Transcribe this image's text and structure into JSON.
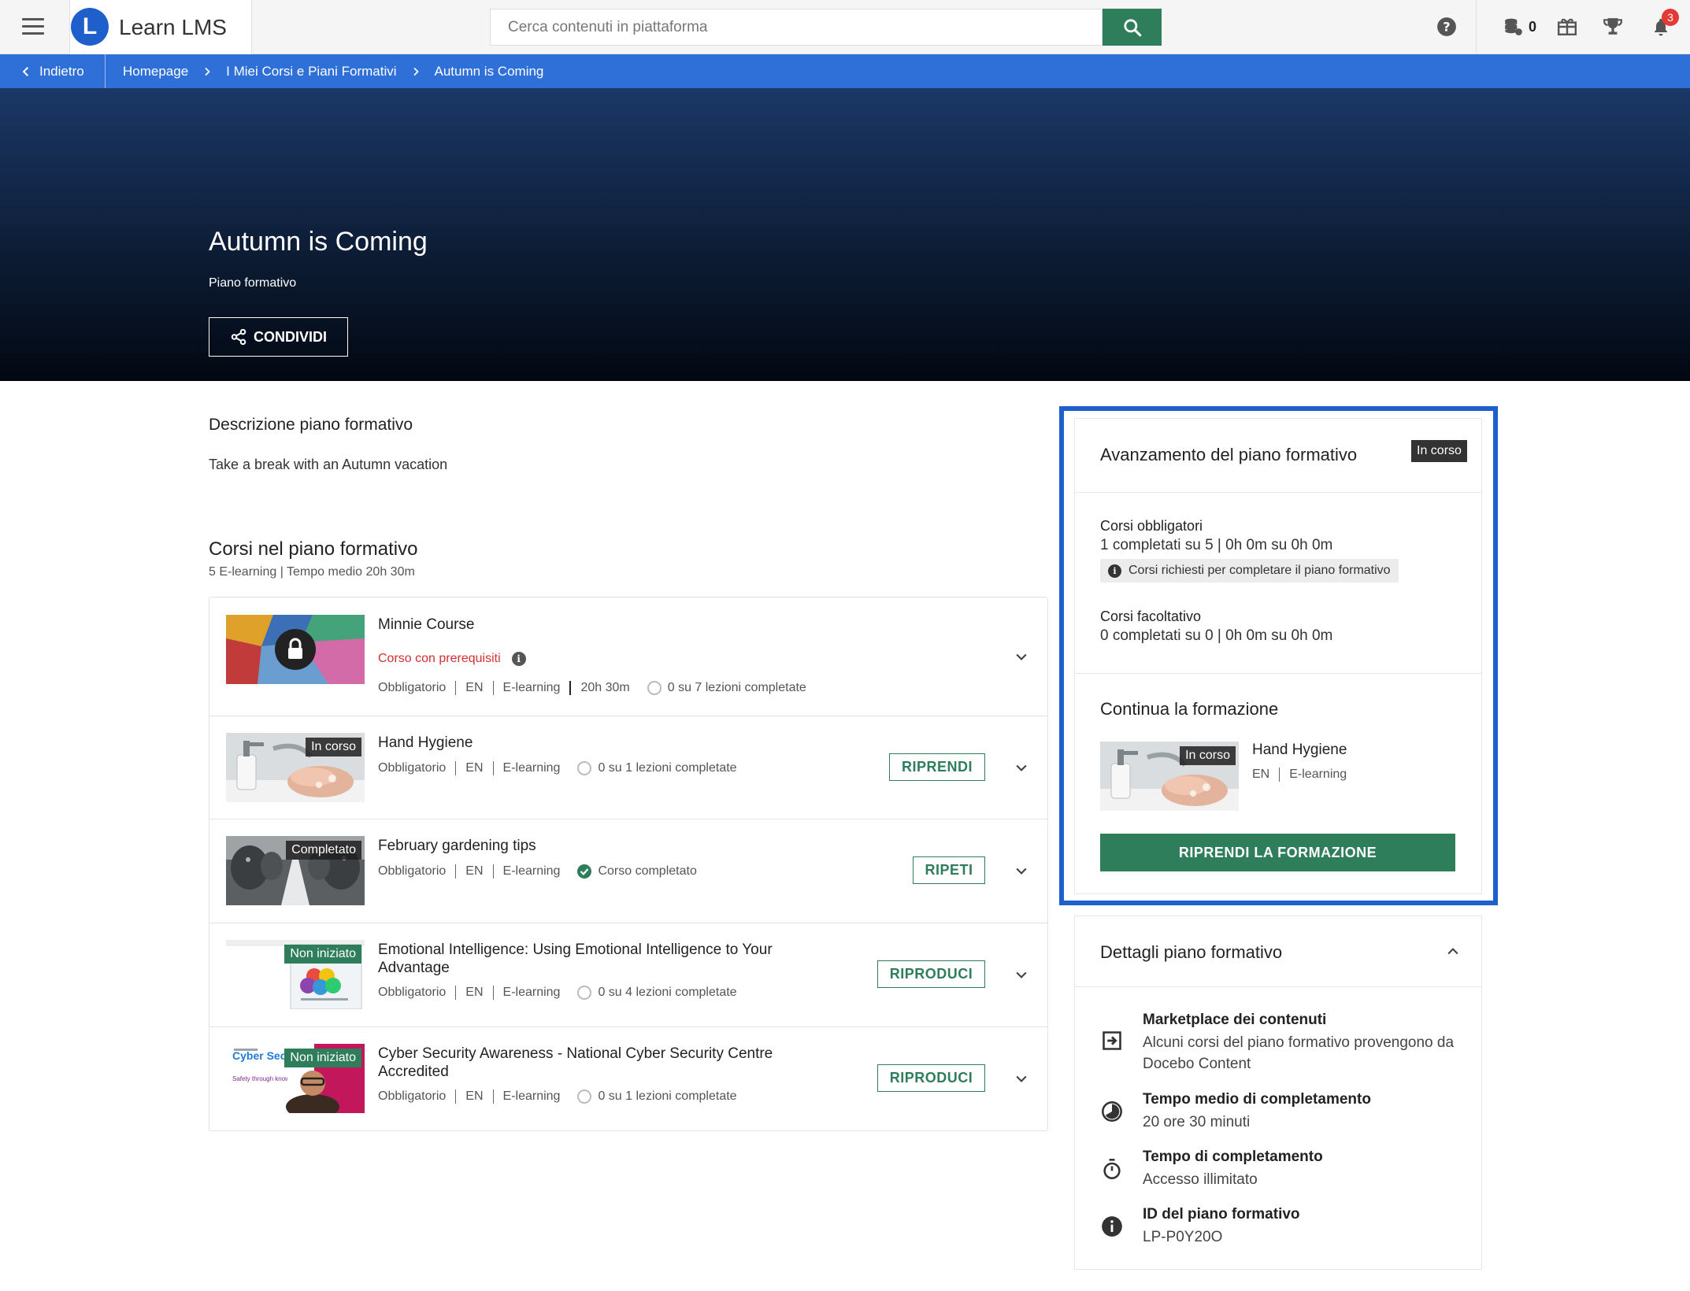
{
  "header": {
    "brand_name": "Learn LMS",
    "brand_logo_letter": "L",
    "search_placeholder": "Cerca contenuti in piattaforma",
    "coins_count": "0",
    "notifications_count": "3",
    "icons": [
      "menu-icon",
      "search-icon",
      "help-icon",
      "coins-icon",
      "gift-icon",
      "trophy-icon",
      "bell-icon"
    ]
  },
  "breadcrumb": {
    "back_label": "Indietro",
    "items": [
      "Homepage",
      "I Miei Corsi e Piani Formativi",
      "Autumn is Coming"
    ]
  },
  "hero": {
    "title": "Autumn is Coming",
    "subtitle": "Piano formativo",
    "share_label": "CONDIVIDI"
  },
  "description": {
    "title": "Descrizione piano formativo",
    "text": "Take a break with an Autumn vacation"
  },
  "courses": {
    "title": "Corsi nel piano formativo",
    "meta": "5 E-learning | Tempo medio 20h 30m",
    "items": [
      {
        "title": "Minnie Course",
        "prereq": "Corso con prerequisiti",
        "type": "Obbligatorio",
        "lang": "EN",
        "format": "E-learning",
        "duration": "20h 30m",
        "progress": "0 su 7 lezioni completate"
      },
      {
        "title": "Hand Hygiene",
        "badge": "In corso",
        "type": "Obbligatorio",
        "lang": "EN",
        "format": "E-learning",
        "progress": "0 su 1 lezioni completate",
        "action": "RIPRENDI"
      },
      {
        "title": "February gardening tips",
        "badge": "Completato",
        "type": "Obbligatorio",
        "lang": "EN",
        "format": "E-learning",
        "progress": "Corso completato",
        "action": "RIPETI"
      },
      {
        "title": "Emotional Intelligence: Using Emotional Intelligence to Your Advantage",
        "badge": "Non iniziato",
        "type": "Obbligatorio",
        "lang": "EN",
        "format": "E-learning",
        "progress": "0 su 4 lezioni completate",
        "action": "RIPRODUCI"
      },
      {
        "title": "Cyber Security Awareness - National Cyber Security Centre Accredited",
        "badge": "Non iniziato",
        "thumb_text": "Cyber Security Awareness",
        "thumb_small": "Safety through knowledge",
        "type": "Obbligatorio",
        "lang": "EN",
        "format": "E-learning",
        "progress": "0 su 1 lezioni completate",
        "action": "RIPRODUCI"
      }
    ]
  },
  "progress_panel": {
    "title": "Avanzamento del piano formativo",
    "status": "In corso",
    "mandatory_label": "Corsi obbligatori",
    "mandatory_value": "1 completati su 5 | 0h 0m su 0h 0m",
    "mandatory_note": "Corsi richiesti per completare il piano formativo",
    "optional_label": "Corsi facoltativo",
    "optional_value": "0 completati su 0 | 0h 0m su 0h 0m",
    "continue_title": "Continua la formazione",
    "continue_course": "Hand Hygiene",
    "continue_badge": "In corso",
    "continue_lang": "EN",
    "continue_format": "E-learning",
    "resume_label": "RIPRENDI LA FORMAZIONE"
  },
  "details": {
    "title": "Dettagli piano formativo",
    "items": [
      {
        "icon": "marketplace-icon",
        "label": "Marketplace dei contenuti",
        "value": "Alcuni corsi del piano formativo provengono da Docebo Content"
      },
      {
        "icon": "clock-icon",
        "label": "Tempo medio di completamento",
        "value": "20 ore 30 minuti"
      },
      {
        "icon": "stopwatch-icon",
        "label": "Tempo di completamento",
        "value": "Accesso illimitato"
      },
      {
        "icon": "info-icon",
        "label": "ID del piano formativo",
        "value": "LP-P0Y20O"
      }
    ]
  },
  "colors": {
    "primary_blue": "#2f6fd8",
    "highlight_blue": "#1f5fcc",
    "accent_green": "#2e7d5b",
    "prereq_red": "#d32f2f"
  }
}
